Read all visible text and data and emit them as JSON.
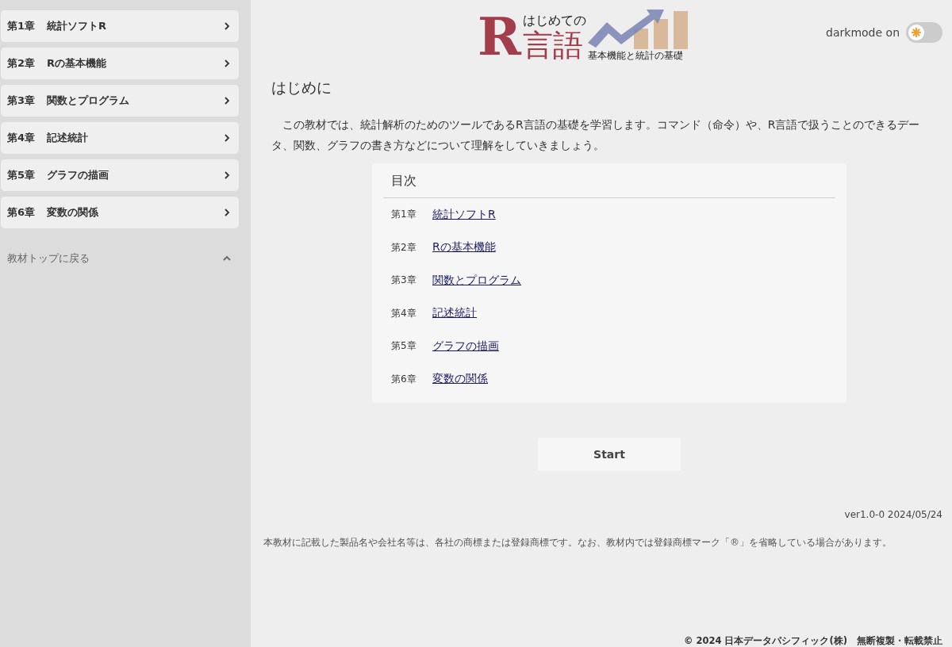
{
  "sidebar": {
    "items": [
      {
        "chapter": "第1章",
        "title": "統計ソフトR"
      },
      {
        "chapter": "第2章",
        "title": "Rの基本機能"
      },
      {
        "chapter": "第3章",
        "title": "関数とプログラム"
      },
      {
        "chapter": "第4章",
        "title": "記述統計"
      },
      {
        "chapter": "第5章",
        "title": "グラフの描画"
      },
      {
        "chapter": "第6章",
        "title": "変数の関係"
      }
    ],
    "back_link": "教材トップに戻る"
  },
  "logo": {
    "letter": "R",
    "top": "はじめての",
    "main": "言語",
    "subtitle": "基本機能と統計の基礎"
  },
  "darkmode": {
    "label": "darkmode on",
    "on": false
  },
  "heading": "はじめに",
  "intro": "この教材では、統計解析のためのツールであるR言語の基礎を学習します。コマンド（命令）や、R言語で扱うことのできるデータ、関数、グラフの書き方などについて理解をしていきましょう。",
  "toc": {
    "title": "目次",
    "items": [
      {
        "chapter": "第1章",
        "title": "統計ソフトR"
      },
      {
        "chapter": "第2章",
        "title": "Rの基本機能"
      },
      {
        "chapter": "第3章",
        "title": "関数とプログラム"
      },
      {
        "chapter": "第4章",
        "title": "記述統計"
      },
      {
        "chapter": "第5章",
        "title": "グラフの描画"
      },
      {
        "chapter": "第6章",
        "title": "変数の関係"
      }
    ]
  },
  "start_button": "Start",
  "version": "ver1.0-0 2024/05/24",
  "notice": "本教材に記載した製品名や会社名等は、各社の商標または登録商標です。なお、教材内では登録商標マーク「®」を省略している場合があります。",
  "copyright": "© 2024 日本データパシフィック(株)　無断複製・転載禁止"
}
